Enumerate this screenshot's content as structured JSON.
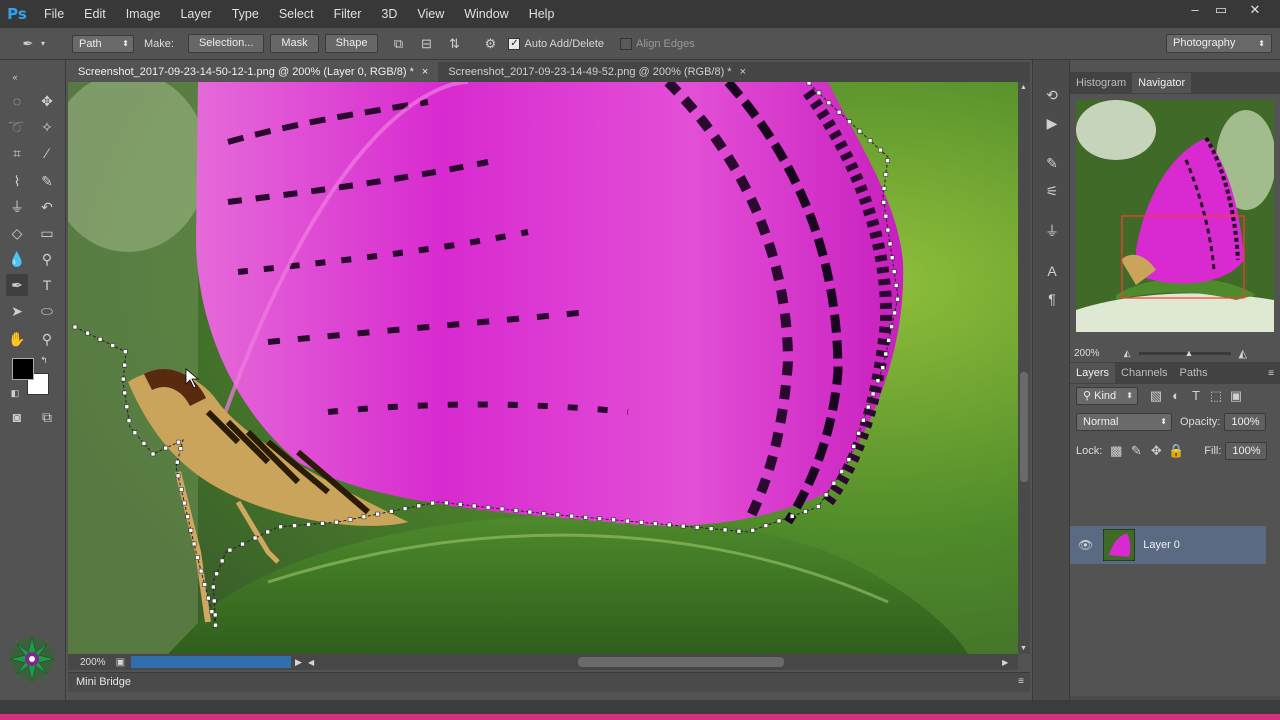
{
  "app": {
    "logo": "Ps"
  },
  "menu": [
    "File",
    "Edit",
    "Image",
    "Layer",
    "Type",
    "Select",
    "Filter",
    "3D",
    "View",
    "Window",
    "Help"
  ],
  "window_controls": [
    "–",
    "▭",
    "✕"
  ],
  "options": {
    "tool_icon": "pen-tool-icon",
    "mode_select": "Path",
    "make_label": "Make:",
    "selection_button": "Selection...",
    "mask_button": "Mask",
    "shape_button": "Shape",
    "auto_add_delete": {
      "label": "Auto Add/Delete",
      "checked": true
    },
    "align_edges": {
      "label": "Align Edges",
      "checked": false
    },
    "workspace": "Photography"
  },
  "doc_tabs": [
    {
      "label": "Screenshot_2017-09-23-14-50-12-1.png @ 200% (Layer 0, RGB/8) *",
      "close": "×",
      "active": true
    },
    {
      "label": "Screenshot_2017-09-23-14-49-52.png @ 200% (RGB/8) *",
      "close": "×",
      "active": false
    }
  ],
  "status": {
    "zoom": "200%"
  },
  "mini_bridge": "Mini Bridge",
  "navigator": {
    "tabs": [
      "Histogram",
      "Navigator"
    ],
    "active": "Navigator",
    "zoom": "200%"
  },
  "layers_panel": {
    "tabs": [
      "Layers",
      "Channels",
      "Paths"
    ],
    "active": "Layers",
    "filter_kind": "Kind",
    "blend_mode": "Normal",
    "opacity_label": "Opacity:",
    "opacity_value": "100%",
    "lock_label": "Lock:",
    "fill_label": "Fill:",
    "fill_value": "100%",
    "layers": [
      {
        "name": "Layer 0",
        "visible": true
      }
    ]
  },
  "colors": {
    "accent": "#2fa3f0",
    "selected_layer": "#5a6a82",
    "wing_magenta": "#d020c8",
    "leaf_green": "#3f7a22"
  }
}
